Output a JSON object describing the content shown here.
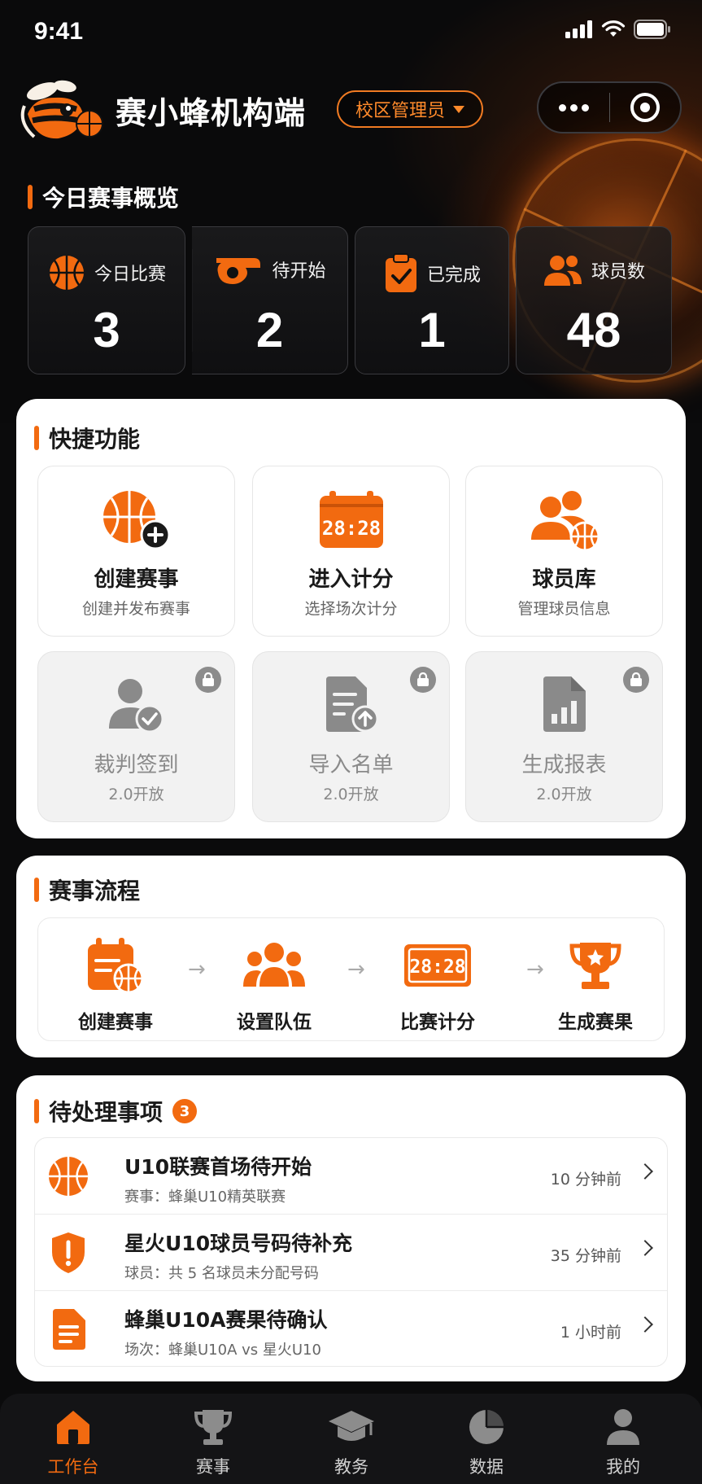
{
  "status_bar": {
    "time": "9:41"
  },
  "header": {
    "app_title": "赛小蜂机构端",
    "role_selector": "校区管理员"
  },
  "overview": {
    "title": "今日赛事概览",
    "stats": [
      {
        "label": "今日比赛",
        "value": "3",
        "icon": "basketball-icon"
      },
      {
        "label": "待开始",
        "value": "2",
        "icon": "whistle-icon"
      },
      {
        "label": "已完成",
        "value": "1",
        "icon": "clipboard-check-icon"
      },
      {
        "label": "球员数",
        "value": "48",
        "icon": "users-icon"
      }
    ]
  },
  "quick": {
    "title": "快捷功能",
    "tiles": [
      {
        "label": "创建赛事",
        "sub": "创建并发布赛事",
        "icon": "basketball-plus-icon",
        "locked": false
      },
      {
        "label": "进入计分",
        "sub": "选择场次计分",
        "icon": "scoreboard-icon",
        "locked": false,
        "score": "28:28"
      },
      {
        "label": "球员库",
        "sub": "管理球员信息",
        "icon": "players-icon",
        "locked": false
      },
      {
        "label": "裁判签到",
        "sub": "2.0开放",
        "icon": "referee-check-icon",
        "locked": true
      },
      {
        "label": "导入名单",
        "sub": "2.0开放",
        "icon": "import-list-icon",
        "locked": true
      },
      {
        "label": "生成报表",
        "sub": "2.0开放",
        "icon": "report-icon",
        "locked": true
      }
    ]
  },
  "flow": {
    "title": "赛事流程",
    "steps": [
      {
        "label": "创建赛事",
        "icon": "calendar-ball-icon"
      },
      {
        "label": "设置队伍",
        "icon": "team-icon"
      },
      {
        "label": "比赛计分",
        "icon": "scoreboard-icon",
        "score": "28:28"
      },
      {
        "label": "生成赛果",
        "icon": "trophy-icon"
      }
    ]
  },
  "pending": {
    "title": "待处理事项",
    "count": "3",
    "items": [
      {
        "title": "U10联赛首场待开始",
        "sub": "赛事：蜂巢U10精英联赛",
        "time": "10 分钟前",
        "icon": "basketball-icon"
      },
      {
        "title": "星火U10球员号码待补充",
        "sub": "球员：共 5 名球员未分配号码",
        "time": "35 分钟前",
        "icon": "shield-alert-icon"
      },
      {
        "title": "蜂巢U10A赛果待确认",
        "sub": "场次：蜂巢U10A vs 星火U10",
        "time": "1 小时前",
        "icon": "document-icon"
      }
    ]
  },
  "tabbar": {
    "tabs": [
      {
        "label": "工作台",
        "icon": "home-icon",
        "active": true
      },
      {
        "label": "赛事",
        "icon": "trophy-icon",
        "active": false
      },
      {
        "label": "教务",
        "icon": "graduation-cap-icon",
        "active": false
      },
      {
        "label": "数据",
        "icon": "pie-chart-icon",
        "active": false
      },
      {
        "label": "我的",
        "icon": "user-icon",
        "active": false
      }
    ]
  },
  "colors": {
    "accent": "#f26a10",
    "background": "#0b0b0c",
    "card": "#ffffff"
  }
}
